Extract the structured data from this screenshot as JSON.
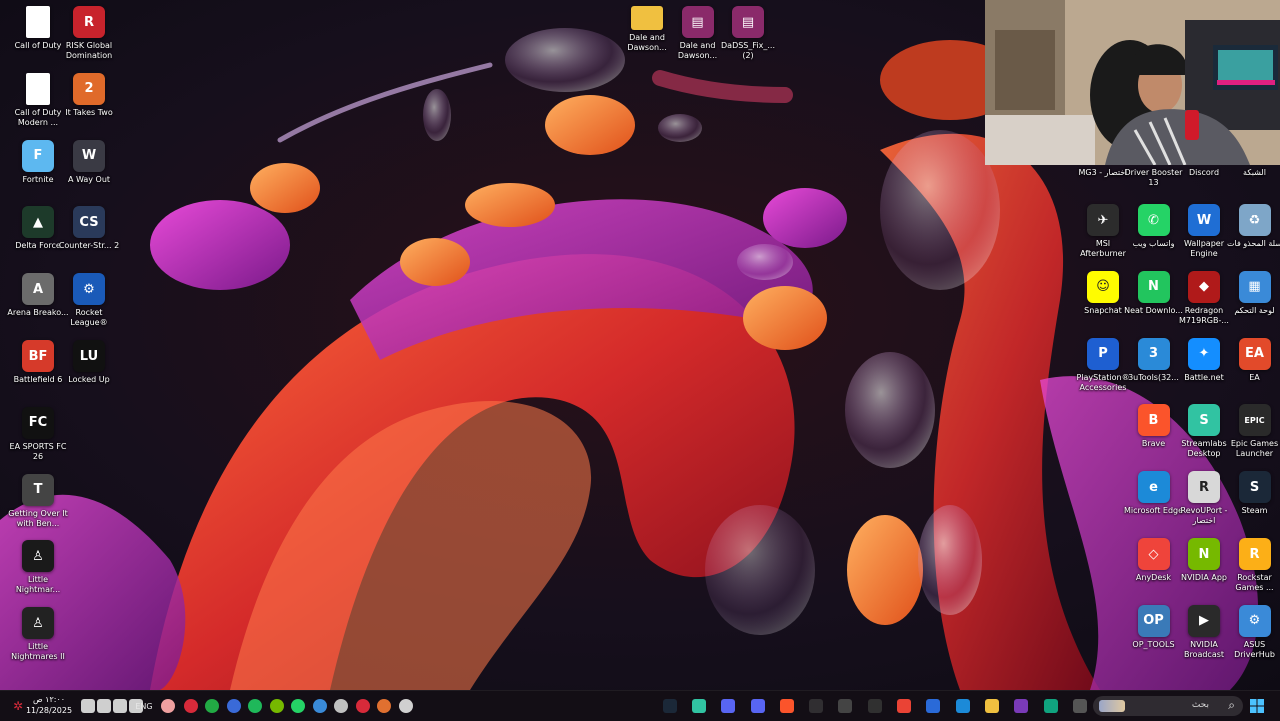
{
  "desktop": {
    "left_col1": [
      {
        "label": "Call of Duty",
        "icon": "document-icon",
        "color": "#ffffff",
        "glyph": ""
      },
      {
        "label": "Call of Duty Modern ...",
        "icon": "document-icon",
        "color": "#ffffff",
        "glyph": ""
      },
      {
        "label": "Fortnite",
        "icon": "fortnite-icon",
        "color": "#5db8f0",
        "glyph": "F"
      },
      {
        "label": "Delta Force",
        "icon": "delta-force-icon",
        "color": "#1d3a2a",
        "glyph": "▲"
      },
      {
        "label": "Arena Breako...",
        "icon": "arena-breakout-icon",
        "color": "#6b6b6b",
        "glyph": "A"
      },
      {
        "label": "Battlefield 6",
        "icon": "battlefield-icon",
        "color": "#d63a2a",
        "glyph": "BF"
      },
      {
        "label": "EA SPORTS FC 26",
        "icon": "fc26-icon",
        "color": "#111111",
        "glyph": "FC"
      },
      {
        "label": "Getting Over It with Ben...",
        "icon": "hammer-icon",
        "color": "#444444",
        "glyph": "T"
      },
      {
        "label": "Little Nightmar...",
        "icon": "little-nightmares-icon",
        "color": "#1a1a1a",
        "glyph": "♙"
      },
      {
        "label": "Little Nightmares II",
        "icon": "little-nightmares-2-icon",
        "color": "#222222",
        "glyph": "♙"
      }
    ],
    "left_col2": [
      {
        "label": "RISK Global Domination",
        "icon": "risk-icon",
        "color": "#c8232c",
        "glyph": "R"
      },
      {
        "label": "It Takes Two",
        "icon": "it-takes-two-icon",
        "color": "#e06a2a",
        "glyph": "2"
      },
      {
        "label": "A Way Out",
        "icon": "a-way-out-icon",
        "color": "#3a3a44",
        "glyph": "W"
      },
      {
        "label": "Counter-Str... 2",
        "icon": "counter-strike-icon",
        "color": "#2a3a5a",
        "glyph": "CS"
      },
      {
        "label": "Rocket League®",
        "icon": "rocket-league-icon",
        "color": "#1a5ab8",
        "glyph": "⚙"
      },
      {
        "label": "Locked Up",
        "icon": "locked-up-icon",
        "color": "#111111",
        "glyph": "LU"
      }
    ],
    "top_files": [
      {
        "label": "Dale and Dawson...",
        "icon": "folder-icon",
        "color": "#f0c040",
        "glyph": ""
      },
      {
        "label": "Dale and Dawson...",
        "icon": "winrar-archive-icon",
        "color": "#8a2a6a",
        "glyph": "▤"
      },
      {
        "label": "DaDSS_Fix_... (2)",
        "icon": "winrar-archive-icon",
        "color": "#8a2a6a",
        "glyph": "▤"
      }
    ],
    "right_row0": [
      {
        "label": "MG3 - اختصار",
        "icon": "shortcut-icon",
        "color": "#333333",
        "glyph": ""
      },
      {
        "label": "Driver Booster 13",
        "icon": "driver-booster-icon",
        "color": "#c0282a",
        "glyph": ""
      },
      {
        "label": "Discord",
        "icon": "discord-icon",
        "color": "#5865f2",
        "glyph": ""
      },
      {
        "label": "الشبكة",
        "icon": "network-icon",
        "color": "#3a6ad8",
        "glyph": ""
      }
    ],
    "right_grid": [
      {
        "label": "MSI Afterburner",
        "icon": "msi-afterburner-icon",
        "color": "#2c2c2c",
        "glyph": "✈"
      },
      {
        "label": "واتساب ويب",
        "icon": "whatsapp-icon",
        "color": "#25d366",
        "glyph": "✆"
      },
      {
        "label": "Wallpaper Engine",
        "icon": "wallpaper-engine-icon",
        "color": "#1f6ed4",
        "glyph": "W"
      },
      {
        "label": "سلة المحذو فات",
        "icon": "recycle-bin-icon",
        "color": "#7ea6c8",
        "glyph": "♻"
      },
      {
        "label": "Snapchat",
        "icon": "snapchat-icon",
        "color": "#fffc00",
        "glyph": "☺"
      },
      {
        "label": "Neat Downlo...",
        "icon": "neat-download-icon",
        "color": "#22c55e",
        "glyph": "N"
      },
      {
        "label": "Redragon M719RGB-...",
        "icon": "redragon-icon",
        "color": "#b01a1a",
        "glyph": "◆"
      },
      {
        "label": "لوحة التحكم",
        "icon": "control-panel-icon",
        "color": "#3a8ad8",
        "glyph": "▦"
      },
      {
        "label": "PlayStation® Accessories",
        "icon": "playstation-icon",
        "color": "#1e5fd1",
        "glyph": "P"
      },
      {
        "label": "3uTools(32...",
        "icon": "3utools-icon",
        "color": "#2a8ad8",
        "glyph": "3"
      },
      {
        "label": "Battle.net",
        "icon": "battlenet-icon",
        "color": "#148eff",
        "glyph": "✦"
      },
      {
        "label": "EA",
        "icon": "ea-icon",
        "color": "#e24a2a",
        "glyph": "EA"
      },
      {
        "label": "",
        "icon": "blank-slot",
        "color": "transparent",
        "glyph": ""
      },
      {
        "label": "Brave",
        "icon": "brave-icon",
        "color": "#fb542b",
        "glyph": "B"
      },
      {
        "label": "Streamlabs Desktop",
        "icon": "streamlabs-icon",
        "color": "#31c3a2",
        "glyph": "S"
      },
      {
        "label": "Epic Games Launcher",
        "icon": "epic-games-icon",
        "color": "#2a2a2a",
        "glyph": "EPIC"
      },
      {
        "label": "",
        "icon": "blank-slot",
        "color": "transparent",
        "glyph": ""
      },
      {
        "label": "Microsoft Edge",
        "icon": "edge-icon",
        "color": "#1c8ad8",
        "glyph": "e"
      },
      {
        "label": "RevoUPort - اختصار",
        "icon": "revo-icon",
        "color": "#d8d8d8",
        "glyph": "R"
      },
      {
        "label": "Steam",
        "icon": "steam-icon",
        "color": "#1b2838",
        "glyph": "S"
      },
      {
        "label": "",
        "icon": "blank-slot",
        "color": "transparent",
        "glyph": ""
      },
      {
        "label": "AnyDesk",
        "icon": "anydesk-icon",
        "color": "#ef443b",
        "glyph": "◇"
      },
      {
        "label": "NVIDIA App",
        "icon": "nvidia-icon",
        "color": "#76b900",
        "glyph": "N"
      },
      {
        "label": "Rockstar Games ...",
        "icon": "rockstar-icon",
        "color": "#fcaf17",
        "glyph": "R"
      },
      {
        "label": "",
        "icon": "blank-slot",
        "color": "transparent",
        "glyph": ""
      },
      {
        "label": "OP_TOOLS",
        "icon": "op-tools-icon",
        "color": "#3a7ab8",
        "glyph": "OP"
      },
      {
        "label": "NVIDIA Broadcast",
        "icon": "nvidia-broadcast-icon",
        "color": "#2a2a2a",
        "glyph": "▶"
      },
      {
        "label": "ASUS DriverHub",
        "icon": "asus-driverhub-icon",
        "color": "#3a8ad8",
        "glyph": "⚙"
      }
    ]
  },
  "taskbar": {
    "time": "١٢:٠٠ ص",
    "date": "11/28/2025",
    "language": "ENG",
    "search_placeholder": "بحث",
    "tray_icons": [
      {
        "icon": "notification-icon",
        "color": "#cfcfcf"
      },
      {
        "icon": "wifi-icon",
        "color": "#cfcfcf"
      },
      {
        "icon": "volume-icon",
        "color": "#cfcfcf"
      },
      {
        "icon": "display-icon",
        "color": "#cfcfcf"
      }
    ],
    "mic_icon": {
      "icon": "microphone-icon",
      "color": "#f0a0a0"
    },
    "tray_apps": [
      {
        "icon": "tray-red-icon",
        "color": "#d82a3a"
      },
      {
        "icon": "tray-play-icon",
        "color": "#22aa44"
      },
      {
        "icon": "tray-blue-icon",
        "color": "#3a6ad8"
      },
      {
        "icon": "tray-green-icon",
        "color": "#1fb85a"
      },
      {
        "icon": "tray-nvidia-icon",
        "color": "#76b900"
      },
      {
        "icon": "tray-whatsapp-icon",
        "color": "#25d366"
      },
      {
        "icon": "tray-update-icon",
        "color": "#3a8ad8"
      },
      {
        "icon": "tray-steam-icon",
        "color": "#c0c0c0"
      },
      {
        "icon": "tray-record-icon",
        "color": "#d82a3a"
      },
      {
        "icon": "tray-app-icon",
        "color": "#e07030"
      },
      {
        "icon": "tray-gear-icon",
        "color": "#d0d0d0"
      }
    ],
    "pinned_apps": [
      {
        "icon": "steam-icon",
        "color": "#1b2838"
      },
      {
        "icon": "streamlabs-icon",
        "color": "#31c3a2"
      },
      {
        "icon": "ring-app-icon",
        "color": "#5865f2"
      },
      {
        "icon": "discord-icon",
        "color": "#5865f2"
      },
      {
        "icon": "brave-icon",
        "color": "#fb542b"
      },
      {
        "icon": "obs-icon",
        "color": "#302e31"
      },
      {
        "icon": "app-icon",
        "color": "#444444"
      },
      {
        "icon": "speedometer-icon",
        "color": "#303030"
      },
      {
        "icon": "chrome-icon",
        "color": "#ea4335"
      },
      {
        "icon": "store-icon",
        "color": "#2a6ad8"
      },
      {
        "icon": "edge-icon",
        "color": "#1c8ad8"
      },
      {
        "icon": "file-explorer-icon",
        "color": "#f0c040"
      },
      {
        "icon": "game-app-icon",
        "color": "#7a3ab8"
      },
      {
        "icon": "chatgpt-icon",
        "color": "#10a37f"
      },
      {
        "icon": "terminal-icon",
        "color": "#555555"
      }
    ]
  }
}
